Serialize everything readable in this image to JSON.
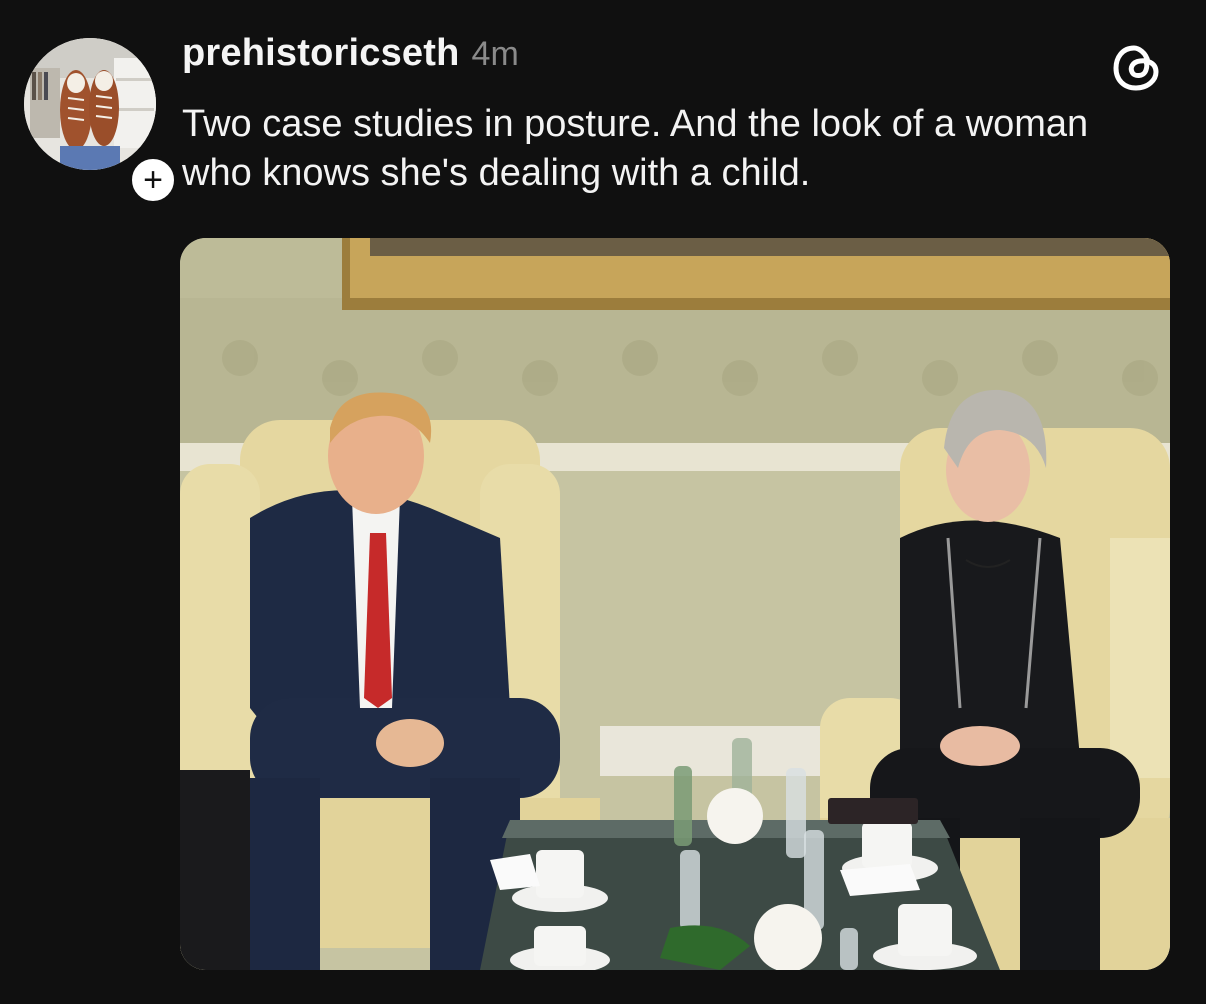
{
  "post": {
    "username": "prehistoricseth",
    "timestamp": "4m",
    "text": "Two case studies in posture. And the look of a woman who knows she's dealing with a child."
  },
  "avatar": {
    "follow_symbol": "+"
  },
  "icons": {
    "app_logo": "threads-logo-icon",
    "follow": "plus-icon"
  },
  "colors": {
    "background": "#101010",
    "text": "#f3f3f3",
    "muted": "#8a8a8a"
  }
}
